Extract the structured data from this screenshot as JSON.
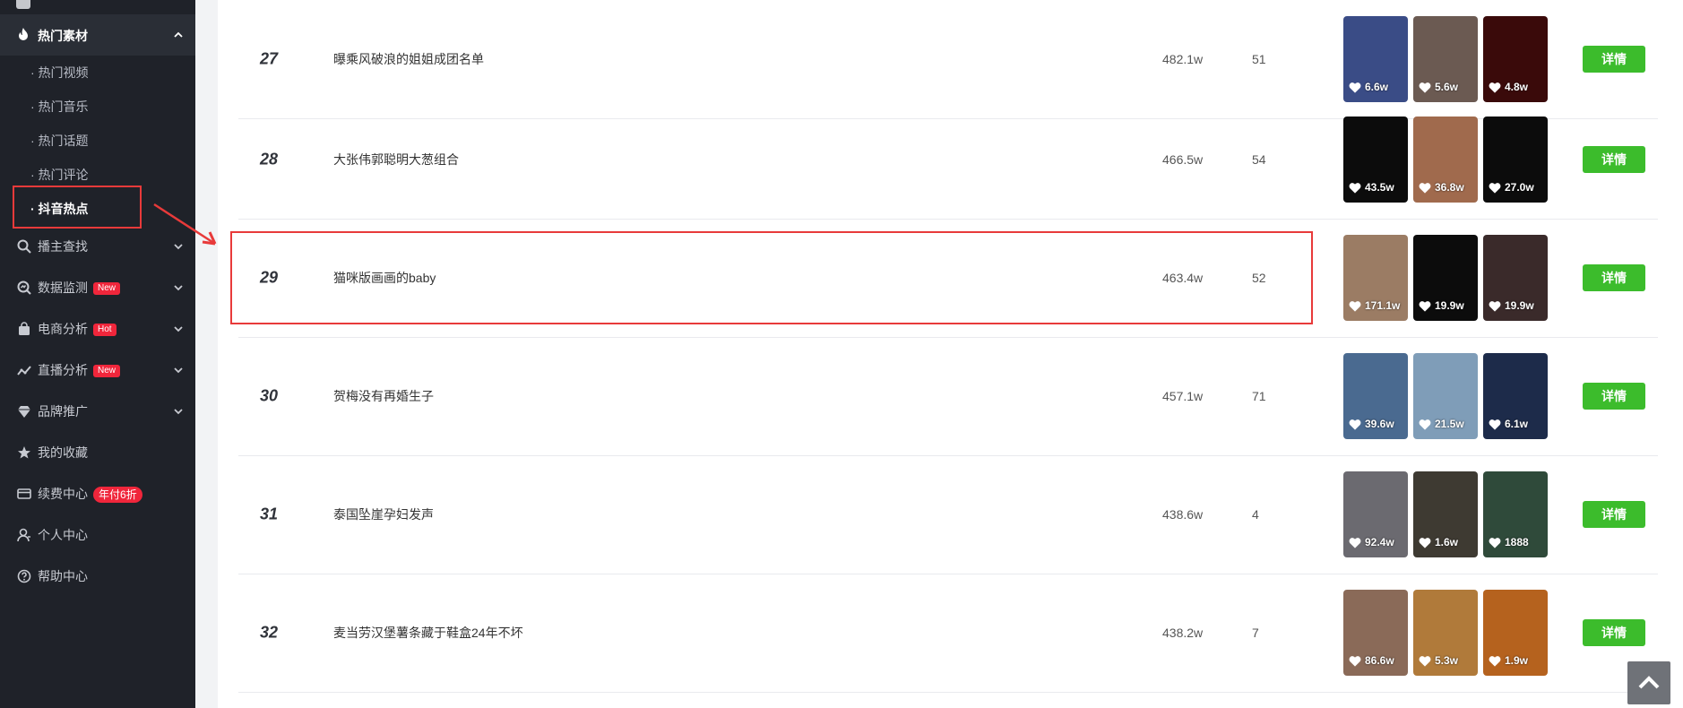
{
  "sidebar": {
    "group": {
      "label": "热门素材",
      "icon": "fire-icon"
    },
    "sub_items": [
      {
        "label": "· 热门视频"
      },
      {
        "label": "· 热门音乐"
      },
      {
        "label": "· 热门话题"
      },
      {
        "label": "· 热门评论"
      },
      {
        "label": "· 抖音热点",
        "active": true
      }
    ],
    "items": [
      {
        "label": "播主查找",
        "icon": "search-icon",
        "chevron": true
      },
      {
        "label": "数据监测",
        "icon": "monitor-icon",
        "chevron": true,
        "badge": "New"
      },
      {
        "label": "电商分析",
        "icon": "bag-icon",
        "chevron": true,
        "badge": "Hot"
      },
      {
        "label": "直播分析",
        "icon": "line-chart-icon",
        "chevron": true,
        "badge": "New"
      },
      {
        "label": "品牌推广",
        "icon": "diamond-icon",
        "chevron": true
      },
      {
        "label": "我的收藏",
        "icon": "star-icon"
      },
      {
        "label": "续费中心",
        "icon": "card-icon",
        "badge": "年付6折"
      },
      {
        "label": "个人中心",
        "icon": "user-icon"
      },
      {
        "label": "帮助中心",
        "icon": "help-icon"
      }
    ]
  },
  "rows": [
    {
      "rank": "27",
      "title": "曝乘风破浪的姐姐成团名单",
      "heat": "482.1w",
      "count": "51",
      "thumbs": [
        {
          "likes": "6.6w",
          "color": "#3a4c86"
        },
        {
          "likes": "5.6w",
          "color": "#6b5a52"
        },
        {
          "likes": "4.8w",
          "color": "#3a0a0a"
        }
      ]
    },
    {
      "rank": "28",
      "title": "大张伟郭聪明大葱组合",
      "heat": "466.5w",
      "count": "54",
      "thumbs": [
        {
          "likes": "43.5w",
          "color": "#0c0c0c"
        },
        {
          "likes": "36.8w",
          "color": "#a06a4d"
        },
        {
          "likes": "27.0w",
          "color": "#0c0c0c"
        }
      ]
    },
    {
      "rank": "29",
      "title": "猫咪版画画的baby",
      "heat": "463.4w",
      "count": "52",
      "thumbs": [
        {
          "likes": "171.1w",
          "color": "#9b7c64"
        },
        {
          "likes": "19.9w",
          "color": "#0c0c0c"
        },
        {
          "likes": "19.9w",
          "color": "#3a2a2a"
        }
      ]
    },
    {
      "rank": "30",
      "title": "贺梅没有再婚生子",
      "heat": "457.1w",
      "count": "71",
      "thumbs": [
        {
          "likes": "39.6w",
          "color": "#4a6a90"
        },
        {
          "likes": "21.5w",
          "color": "#7f9db8"
        },
        {
          "likes": "6.1w",
          "color": "#1d2b4a"
        }
      ]
    },
    {
      "rank": "31",
      "title": "泰国坠崖孕妇发声",
      "heat": "438.6w",
      "count": "4",
      "thumbs": [
        {
          "likes": "92.4w",
          "color": "#6b6a70"
        },
        {
          "likes": "1.6w",
          "color": "#3e3a32"
        },
        {
          "likes": "1888",
          "color": "#2f4a3a"
        }
      ]
    },
    {
      "rank": "32",
      "title": "麦当劳汉堡薯条藏于鞋盒24年不坏",
      "heat": "438.2w",
      "count": "7",
      "thumbs": [
        {
          "likes": "86.6w",
          "color": "#8a6a58"
        },
        {
          "likes": "5.3w",
          "color": "#b07a3a"
        },
        {
          "likes": "1.9w",
          "color": "#b5621e"
        }
      ]
    }
  ],
  "detail_label": "详情"
}
